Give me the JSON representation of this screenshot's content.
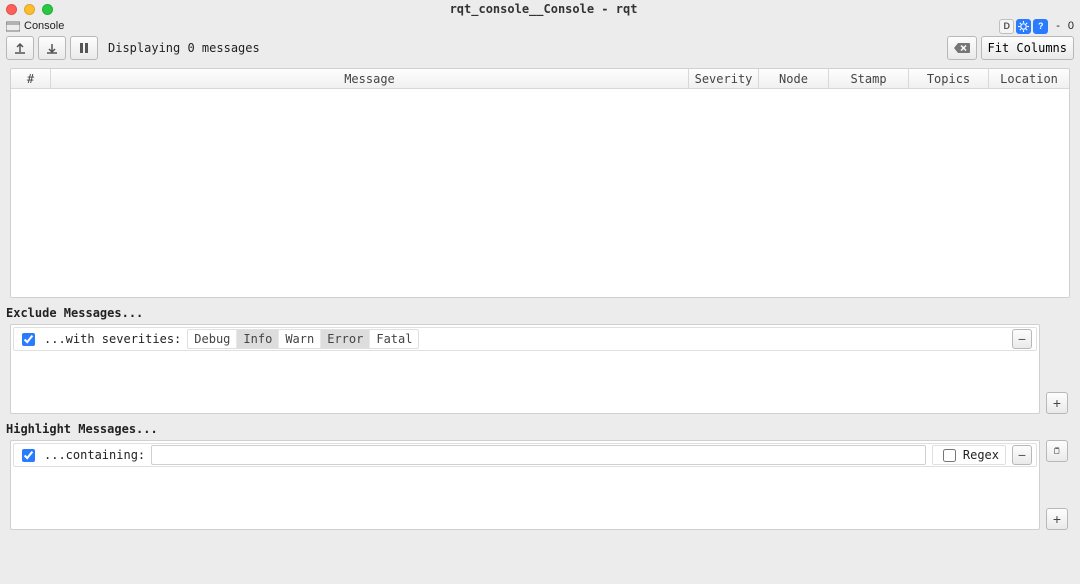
{
  "window": {
    "title": "rqt_console__Console - rqt"
  },
  "dock": {
    "title": "Console",
    "d_label": "D",
    "minimize_label": "-",
    "restore_count": "0"
  },
  "toolbar": {
    "status_text": "Displaying 0 messages",
    "fit_columns_label": "Fit Columns"
  },
  "table": {
    "columns": [
      "#",
      "Message",
      "Severity",
      "Node",
      "Stamp",
      "Topics",
      "Location"
    ]
  },
  "exclude": {
    "section_label": "Exclude Messages...",
    "row_label": "...with severities:",
    "severities": [
      {
        "label": "Debug",
        "selected": false
      },
      {
        "label": "Info",
        "selected": true
      },
      {
        "label": "Warn",
        "selected": false
      },
      {
        "label": "Error",
        "selected": true
      },
      {
        "label": "Fatal",
        "selected": false
      }
    ],
    "minus_label": "−",
    "plus_label": "+"
  },
  "highlight": {
    "section_label": "Highlight Messages...",
    "row_label": "...containing:",
    "input_value": "",
    "regex_label": "Regex",
    "minus_label": "−",
    "plus_label": "+",
    "extra_button_icon": "copy-icon"
  }
}
